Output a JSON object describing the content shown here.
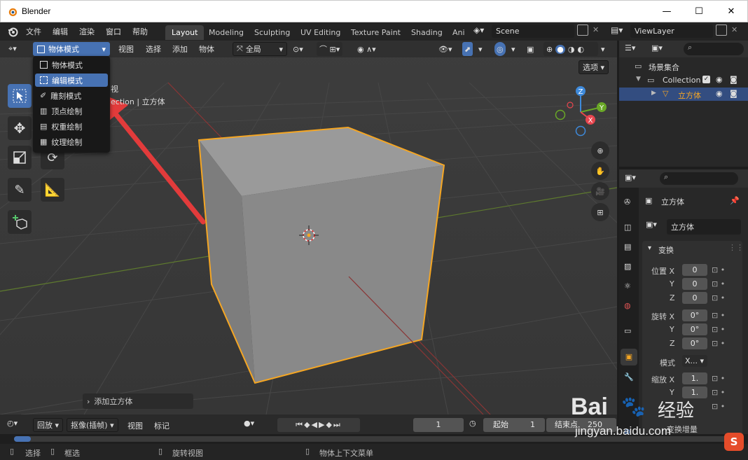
{
  "window": {
    "title": "Blender"
  },
  "menu": {
    "items": [
      "文件",
      "编辑",
      "渲染",
      "窗口",
      "帮助"
    ],
    "workspace_tabs": [
      "Layout",
      "Modeling",
      "Sculpting",
      "UV Editing",
      "Texture Paint",
      "Shading",
      "Ani"
    ],
    "active_tab": "Layout",
    "scene": "Scene",
    "view_layer": "ViewLayer"
  },
  "viewport_header": {
    "mode": "物体模式",
    "menus": [
      "视图",
      "选择",
      "添加",
      "物体"
    ],
    "transform_orientation": "全局",
    "options": "选项"
  },
  "viewport": {
    "view_label": "视",
    "collection_label": "ection | 立方体",
    "last_op": "添加立方体"
  },
  "mode_menu": {
    "items": [
      {
        "label": "物体模式",
        "icon": "object-mode-icon"
      },
      {
        "label": "编辑模式",
        "icon": "edit-mode-icon",
        "highlight": true
      },
      {
        "label": "雕刻模式",
        "icon": "sculpt-mode-icon"
      },
      {
        "label": "顶点绘制",
        "icon": "vertex-paint-icon"
      },
      {
        "label": "权重绘制",
        "icon": "weight-paint-icon"
      },
      {
        "label": "纹理绘制",
        "icon": "texture-paint-icon"
      }
    ]
  },
  "gizmo": {
    "x": "X",
    "y": "Y",
    "z": "Z"
  },
  "outliner": {
    "scene_collection": "场景集合",
    "collection": "Collection",
    "object": "立方体"
  },
  "properties": {
    "object_name": "立方体",
    "data_name": "立方体",
    "panel_transform": "变换",
    "location_label": "位置 X",
    "rotation_label": "旋转 X",
    "scale_label": "缩放 X",
    "y": "Y",
    "z": "Z",
    "loc": [
      "0",
      "0",
      "0"
    ],
    "rot": [
      "0°",
      "0°",
      "0°"
    ],
    "scale": [
      "1.",
      "1."
    ],
    "mode_label": "模式",
    "mode_value": "X...",
    "delta": "变换增量"
  },
  "timeline": {
    "playback": "回放",
    "keying": "抠像(插帧)",
    "view": "视图",
    "marker": "标记",
    "current_frame": "1",
    "start_label": "起始",
    "start": "1",
    "end_label": "结束点",
    "end": "250"
  },
  "status": {
    "select": "选择",
    "box_select": "框选",
    "rotate_view": "旋转视图",
    "context_menu": "物体上下文菜单"
  },
  "watermark": {
    "brand": "Bai",
    "brand2": "经验",
    "url": "jingyan.baidu.com"
  },
  "colors": {
    "accent": "#4772b3",
    "selection": "#f5a623",
    "arrow": "#e23b3b",
    "x_axis": "#e8464f",
    "y_axis": "#6aa827",
    "z_axis": "#3e8adb"
  }
}
